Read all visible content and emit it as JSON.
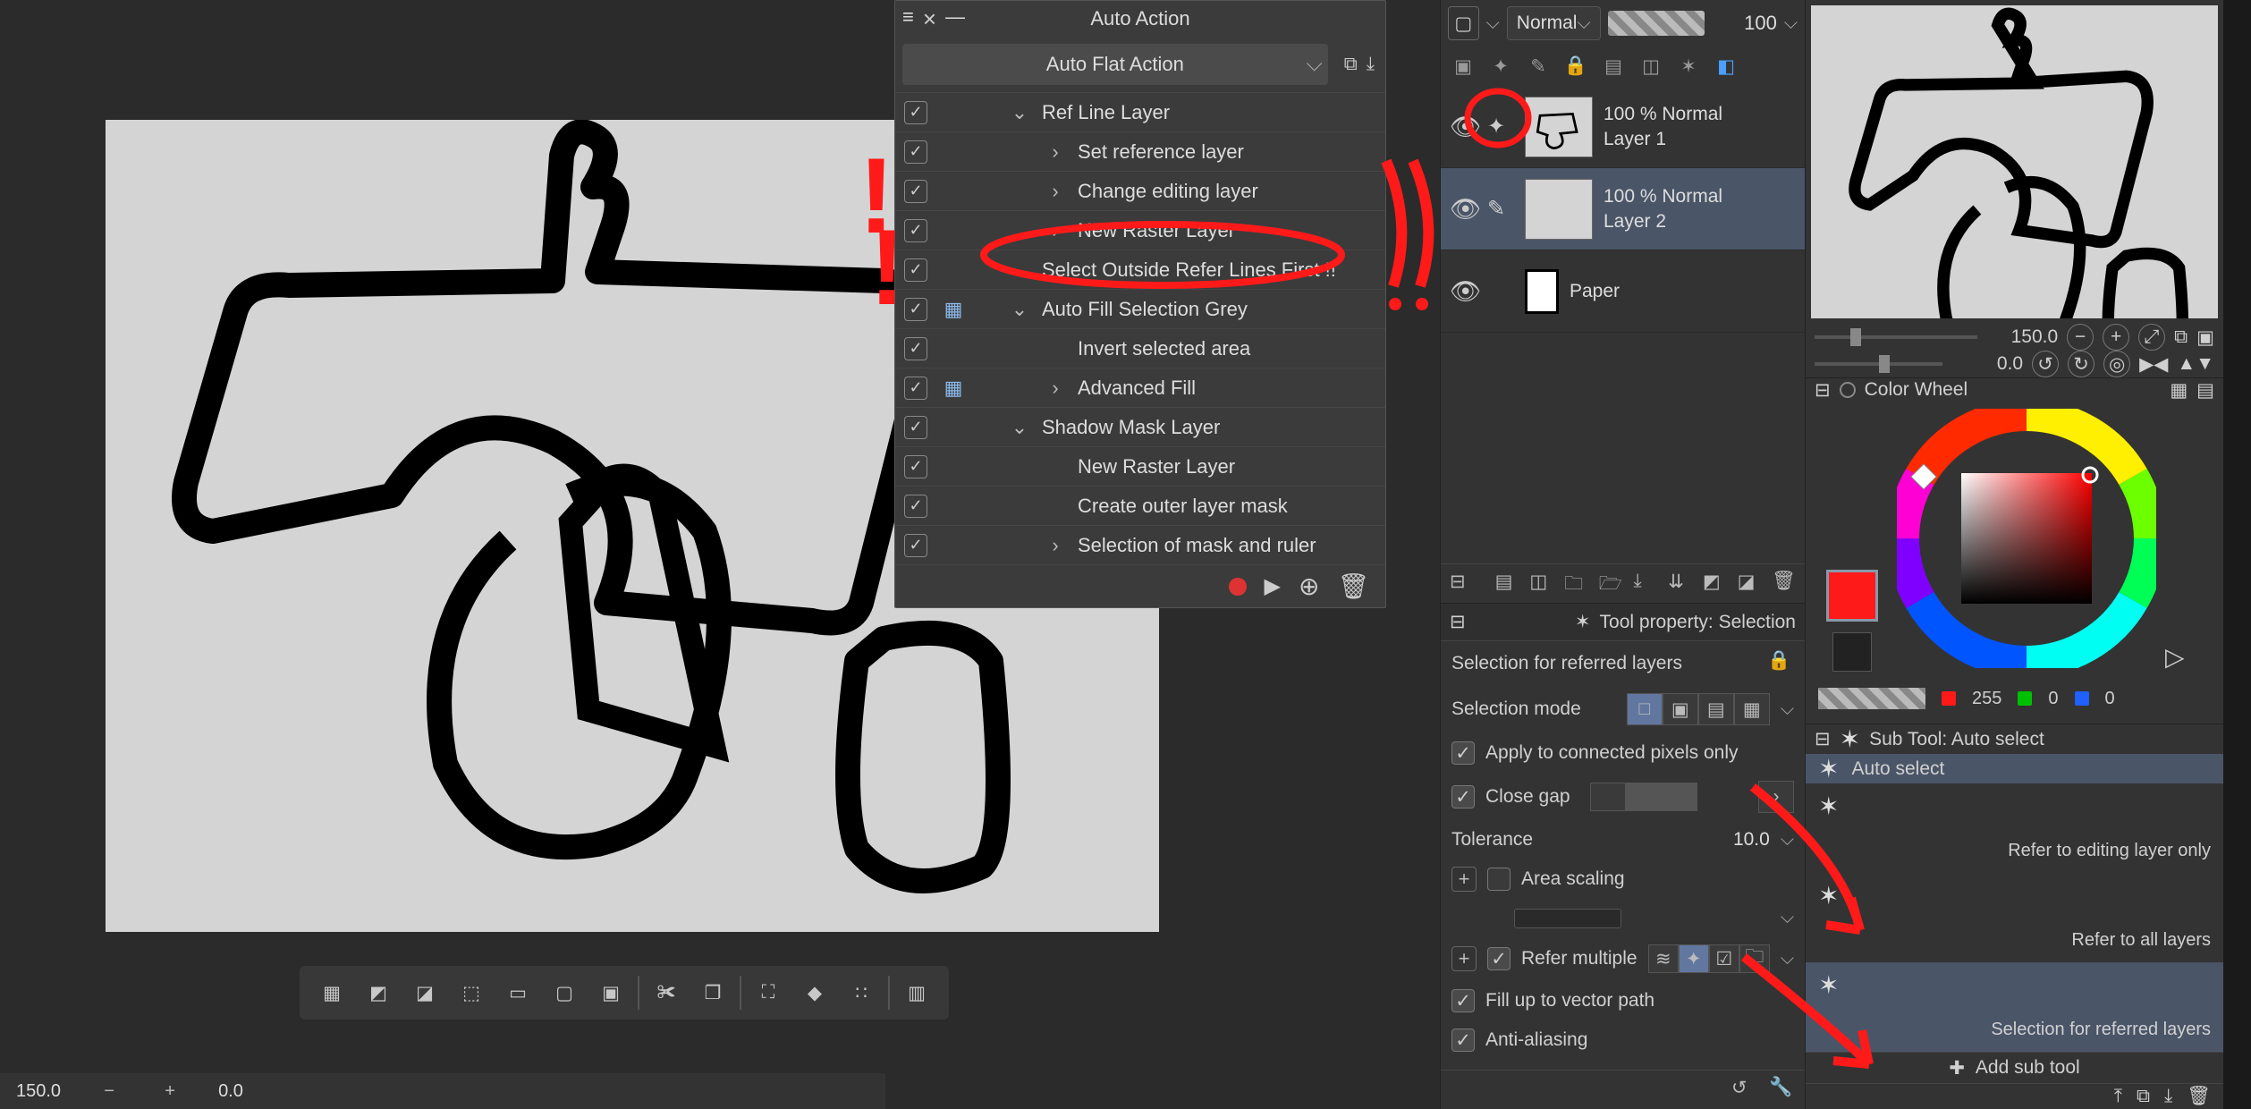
{
  "auto_action": {
    "title": "Auto Action",
    "set_name": "Auto Flat Action",
    "items": [
      {
        "label": "Ref Line Layer",
        "arrow": "down",
        "checked": true,
        "indent": 1,
        "cmd": false
      },
      {
        "label": "Set reference layer",
        "arrow": "right",
        "checked": true,
        "indent": 2,
        "cmd": false
      },
      {
        "label": "Change editing layer",
        "arrow": "right",
        "checked": true,
        "indent": 2,
        "cmd": false
      },
      {
        "label": "New Raster Layer",
        "arrow": "right",
        "checked": true,
        "indent": 2,
        "cmd": false
      },
      {
        "label": "Select Outside Refer Lines First !!",
        "arrow": "down",
        "checked": true,
        "indent": 1,
        "cmd": false
      },
      {
        "label": "Auto Fill Selection Grey",
        "arrow": "down",
        "checked": true,
        "indent": 1,
        "cmd": true
      },
      {
        "label": "Invert selected area",
        "arrow": "",
        "checked": true,
        "indent": 2,
        "cmd": false
      },
      {
        "label": "Advanced Fill",
        "arrow": "right",
        "checked": true,
        "indent": 2,
        "cmd": true
      },
      {
        "label": "Shadow Mask Layer",
        "arrow": "down",
        "checked": true,
        "indent": 1,
        "cmd": false
      },
      {
        "label": "New Raster Layer",
        "arrow": "",
        "checked": true,
        "indent": 2,
        "cmd": false
      },
      {
        "label": "Create outer layer mask",
        "arrow": "",
        "checked": true,
        "indent": 2,
        "cmd": false
      },
      {
        "label": "Selection of mask and ruler",
        "arrow": "right",
        "checked": true,
        "indent": 2,
        "cmd": false
      }
    ]
  },
  "layer_panel": {
    "blend_mode": "Normal",
    "opacity": "100",
    "layers": [
      {
        "name": "Layer 1",
        "opacity": "100 %",
        "mode": "Normal",
        "selected": false,
        "ref": true
      },
      {
        "name": "Layer 2",
        "opacity": "100 %",
        "mode": "Normal",
        "selected": true,
        "ref": false
      },
      {
        "name": "Paper",
        "opacity": "",
        "mode": "",
        "selected": false,
        "ref": false
      }
    ]
  },
  "tool_property": {
    "title": "Tool property: Selection",
    "tool_name": "Selection for referred layers",
    "selection_mode_label": "Selection mode",
    "apply_connected": "Apply to connected pixels only",
    "close_gap": "Close gap",
    "tolerance_label": "Tolerance",
    "tolerance_value": "10.0",
    "area_scaling": "Area scaling",
    "refer_multiple": "Refer multiple",
    "fill_vector": "Fill up to vector path",
    "anti_alias": "Anti-aliasing"
  },
  "navigator": {
    "zoom": "150.0",
    "angle": "0.0"
  },
  "color_wheel": {
    "title": "Color Wheel",
    "r": "255",
    "g": "0",
    "b": "0"
  },
  "sub_tool": {
    "title": "Sub Tool: Auto select",
    "selected": "Auto select",
    "options": [
      "Refer to editing layer only",
      "Refer to all layers",
      "Selection for referred layers"
    ],
    "add_label": "Add sub tool"
  },
  "status": {
    "zoom": "150.0",
    "angle": "0.0"
  }
}
